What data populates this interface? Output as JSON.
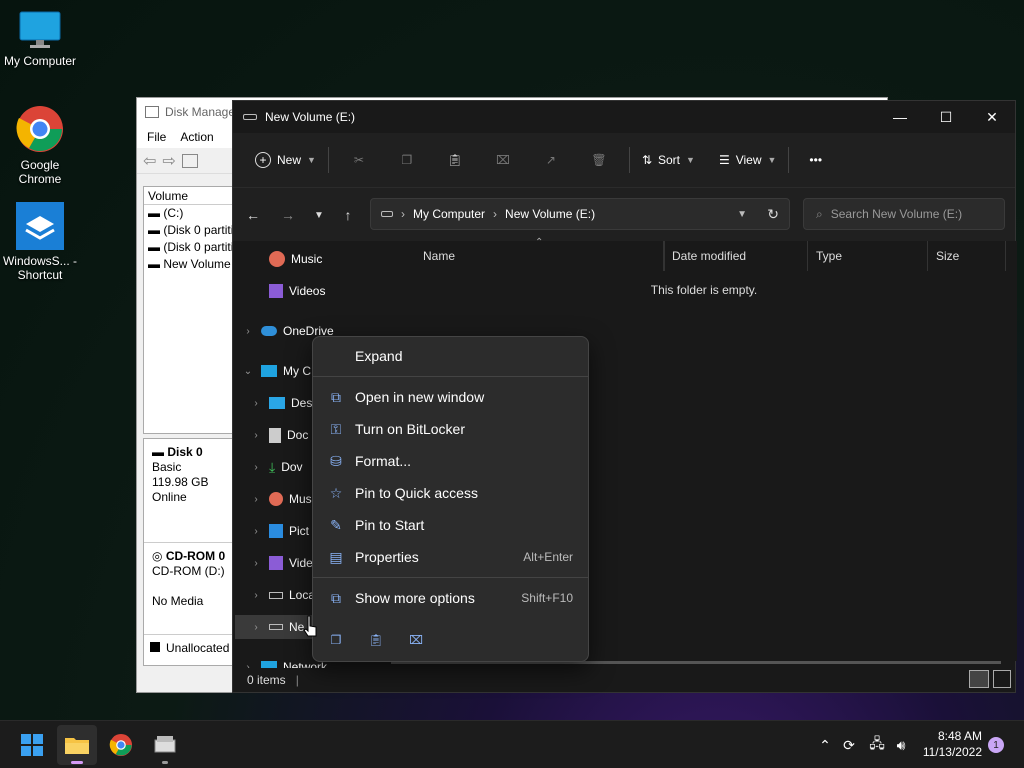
{
  "desktop": {
    "icons": [
      {
        "label": "My Computer"
      },
      {
        "label": "Google Chrome"
      },
      {
        "label": "WindowsS... - Shortcut"
      }
    ]
  },
  "disk_mgmt": {
    "title": "Disk Manage",
    "menu": [
      "File",
      "Action"
    ],
    "volume_header": "Volume",
    "volumes": [
      "(C:)",
      "(Disk 0 partiti",
      "(Disk 0 partiti",
      "New Volume"
    ],
    "disk0": {
      "name": "Disk 0",
      "type": "Basic",
      "size": "119.98 GB",
      "status": "Online"
    },
    "cdrom": {
      "name": "CD-ROM 0",
      "drive": "CD-ROM (D:)",
      "media": "No Media"
    },
    "legend": "Unallocated"
  },
  "explorer": {
    "title": "New Volume (E:)",
    "window_controls": {
      "minimize": "—",
      "maximize": "☐",
      "close": "✕"
    },
    "cmd": {
      "new": "New",
      "sort": "Sort",
      "view": "View",
      "more": "•••"
    },
    "breadcrumb": [
      "My Computer",
      "New Volume (E:)"
    ],
    "search_placeholder": "Search New Volume (E:)",
    "nav": {
      "music": "Music",
      "videos": "Videos",
      "onedrive": "OneDrive",
      "mycomputer": "My C",
      "desktop": "Des",
      "documents": "Doc",
      "downloads": "Dov",
      "music2": "Mus",
      "pictures": "Pict",
      "videos2": "Vide",
      "local": "Loca",
      "newvol": "Ne",
      "network": "Network"
    },
    "columns": [
      "Name",
      "Date modified",
      "Type",
      "Size"
    ],
    "empty_text": "This folder is empty.",
    "status": "0 items"
  },
  "context_menu": {
    "items": [
      {
        "label": "Expand",
        "shortcut": ""
      },
      {
        "label": "Open in new window",
        "shortcut": ""
      },
      {
        "label": "Turn on BitLocker",
        "shortcut": ""
      },
      {
        "label": "Format...",
        "shortcut": ""
      },
      {
        "label": "Pin to Quick access",
        "shortcut": ""
      },
      {
        "label": "Pin to Start",
        "shortcut": ""
      },
      {
        "label": "Properties",
        "shortcut": "Alt+Enter"
      },
      {
        "label": "Show more options",
        "shortcut": "Shift+F10"
      }
    ]
  },
  "taskbar": {
    "time": "8:48 AM",
    "date": "11/13/2022",
    "notification_count": "1"
  }
}
